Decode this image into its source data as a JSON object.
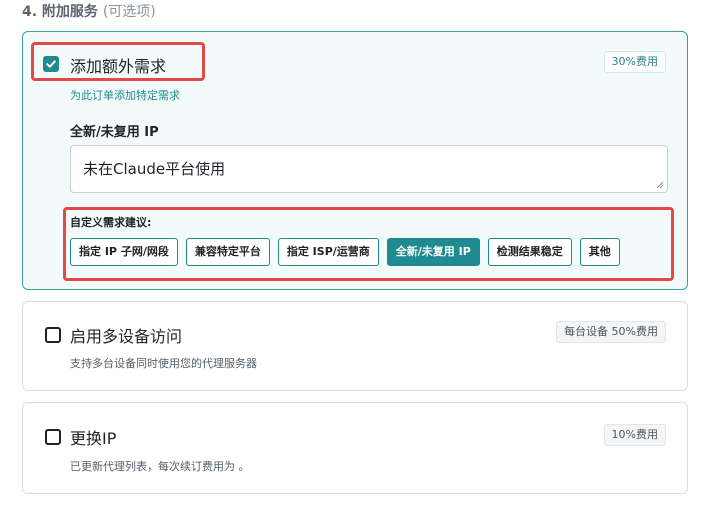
{
  "section": {
    "title": "4. 附加服务",
    "optional": "(可选项)"
  },
  "services": [
    {
      "title": "添加额外需求",
      "fee": "30%费用",
      "hint": "为此订单添加特定需求",
      "checked": true,
      "field": {
        "label": "全新/未复用 IP",
        "value": "未在Claude平台使用"
      },
      "suggestions": {
        "label": "自定义需求建议:",
        "chips": [
          {
            "label": "指定 IP 子网/网段",
            "selected": false
          },
          {
            "label": "兼容特定平台",
            "selected": false
          },
          {
            "label": "指定 ISP/运营商",
            "selected": false
          },
          {
            "label": "全新/未复用 IP",
            "selected": true
          },
          {
            "label": "检测结果稳定",
            "selected": false
          },
          {
            "label": "其他",
            "selected": false
          }
        ]
      }
    },
    {
      "title": "启用多设备访问",
      "fee": "每台设备 50%费用",
      "hint": "支持多台设备同时使用您的代理服务器",
      "checked": false
    },
    {
      "title": "更换IP",
      "fee": "10%费用",
      "hint": "已更新代理列表，每次续订费用为 。",
      "checked": false
    }
  ],
  "colors": {
    "accent": "#1f8a8f",
    "highlight": "#e24a4a",
    "active_bg": "#f3fafa"
  }
}
